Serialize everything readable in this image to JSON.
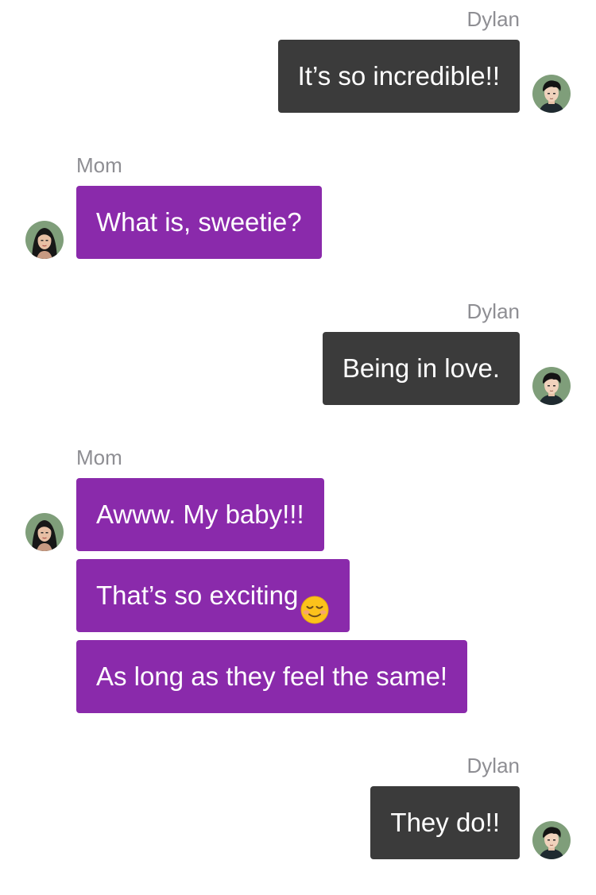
{
  "conversation": {
    "senders": {
      "self": "Dylan",
      "other": "Mom"
    },
    "groups": [
      {
        "sender": "Dylan",
        "direction": "outgoing",
        "messages": [
          "It’s so incredible!!"
        ]
      },
      {
        "sender": "Mom",
        "direction": "incoming",
        "messages": [
          "What is, sweetie?"
        ]
      },
      {
        "sender": "Dylan",
        "direction": "outgoing",
        "messages": [
          "Being in love."
        ]
      },
      {
        "sender": "Mom",
        "direction": "incoming",
        "messages": [
          "Awww. My baby!!!",
          "That’s so exciting",
          "As long as they feel the same!"
        ]
      },
      {
        "sender": "Dylan",
        "direction": "outgoing",
        "messages": [
          "They do!!"
        ]
      }
    ],
    "emoji": {
      "message_ref": "group 4, message 2",
      "icon": "smiling-face-emoji"
    },
    "colors": {
      "outgoing_bubble": "#3b3b3b",
      "incoming_bubble": "#8a2aab",
      "bubble_text": "#ffffff",
      "sender_name": "#8e8e93",
      "background": "#ffffff"
    },
    "avatars": {
      "self_icon": "dylan-avatar-icon",
      "other_icon": "mom-avatar-icon"
    }
  }
}
